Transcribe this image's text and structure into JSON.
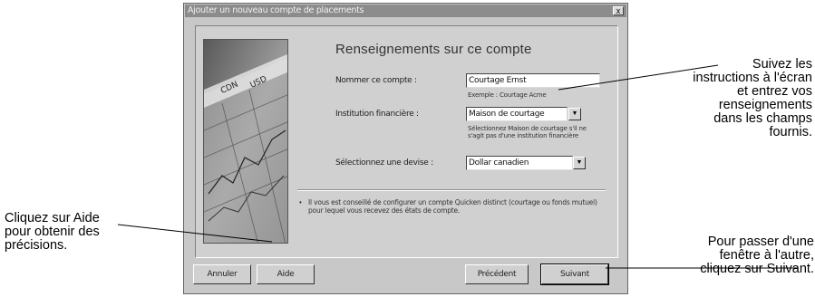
{
  "window": {
    "title": "Ajouter un nouveau compte de placements",
    "close_label": "x"
  },
  "dialog": {
    "heading": "Renseignements sur ce compte",
    "fields": [
      {
        "label": "Nommer ce compte :",
        "value": "Courtage Ernst",
        "hint": "Exemple : Courtage Acme"
      },
      {
        "label": "Institution financière :",
        "value": "Maison de courtage",
        "hint": "Sélectionnez Maison de courtage s'il ne s'agit pas d'une institution financière"
      },
      {
        "label": "Sélectionnez une devise :",
        "value": "Dollar canadien",
        "hint": ""
      }
    ],
    "note": "Il vous est conseillé de configurer un compte Quicken distinct (courtage ou fonds mutuel) pour lequel vous recevez des états de compte.",
    "buttons": {
      "cancel": "Annuler",
      "help": "Aide",
      "back": "Précédent",
      "next": "Suivant"
    }
  },
  "callouts": {
    "right": [
      "Suivez les",
      "instructions à l'écran",
      "et entrez vos",
      "renseignements",
      "dans les champs",
      "fournis."
    ],
    "left": [
      "Cliquez sur Aide",
      "pour obtenir des",
      "précisions."
    ],
    "bottom": [
      "Pour passer d'une",
      "fenêtre à l'autre,",
      "cliquez sur Suivant."
    ]
  }
}
